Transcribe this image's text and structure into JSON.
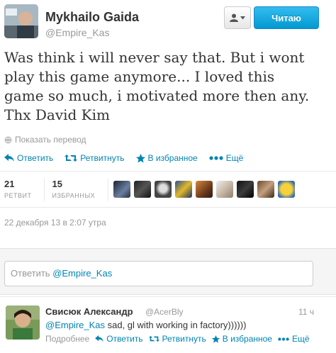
{
  "header": {
    "fullname": "Mykhailo Gaida",
    "username": "@Empire_Kas",
    "follow_label": "Читаю"
  },
  "tweet": {
    "text": "Was think i will never say that. But i wont play this game anymore... I loved this game so much, i motivated more then any. Thx David Kim",
    "translate_label": "Показать перевод",
    "timestamp": "22 декабря 13 в 2:07 утра"
  },
  "actions": {
    "reply": "Ответить",
    "retweet": "Ретвитнуть",
    "favorite": "В избранное",
    "more": "Ещё"
  },
  "stats": {
    "retweets_count": "21",
    "retweets_label": "РЕТВИТ",
    "favorites_count": "15",
    "favorites_label": "ИЗБРАННЫХ"
  },
  "reply_box": {
    "prefix": "Ответить ",
    "mention": "@Empire_Kas"
  },
  "reply": {
    "fullname": "Свисюк Александр",
    "username": "@AcerBly",
    "time": "11 ч",
    "mention": "@Empire_Kas",
    "text": " sad, gl with working in factory))))))",
    "details": "Подробнее",
    "reply": "Ответить",
    "retweet": "Ретвитнуть",
    "favorite": "В избранное",
    "more": "Ещё"
  },
  "colors": {
    "link": "#0084b4",
    "follow_button": "#019ad2",
    "muted": "#999999"
  }
}
